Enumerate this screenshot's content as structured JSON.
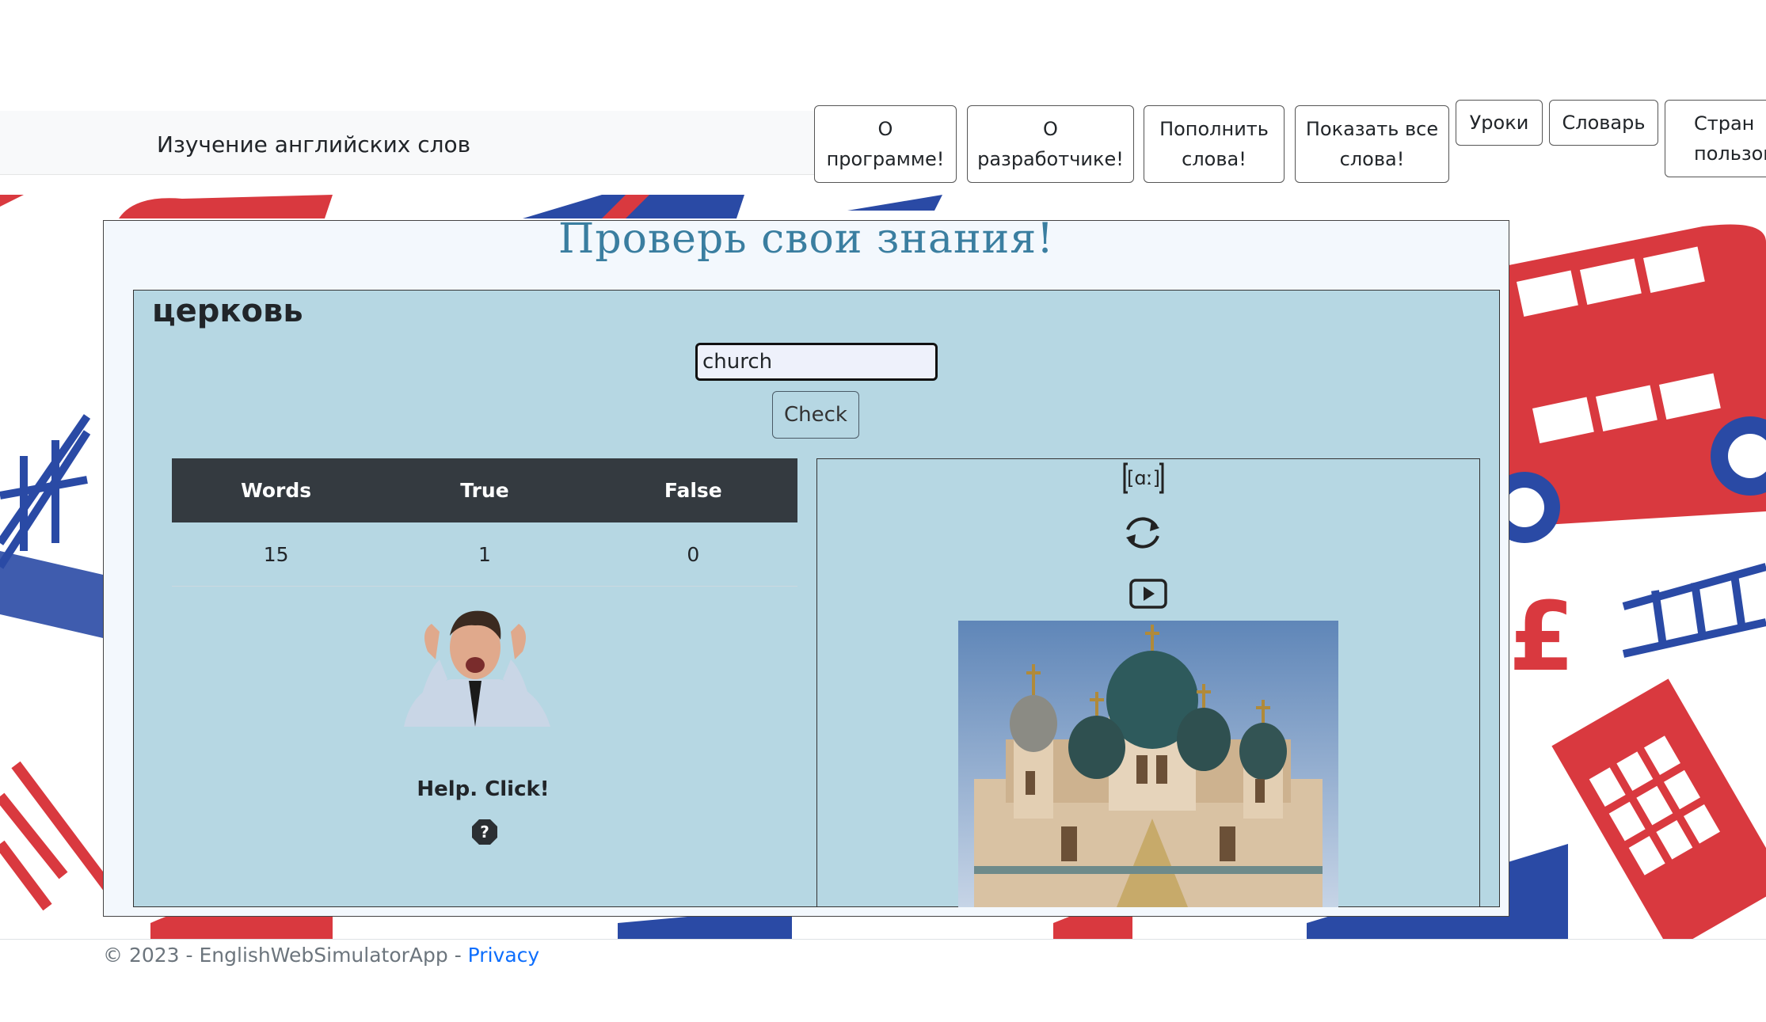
{
  "navbar": {
    "brand": "Изучение английских слов",
    "items": [
      {
        "line1": "О",
        "line2": "программе!"
      },
      {
        "line1": "О",
        "line2": "разработчике!"
      },
      {
        "line1": "Пополнить",
        "line2": "слова!"
      },
      {
        "line1": "Показать все",
        "line2": "слова!"
      },
      {
        "line1": "Уроки"
      },
      {
        "line1": "Словарь"
      },
      {
        "line1": "Стран",
        "line2": "пользов"
      }
    ]
  },
  "main": {
    "title": "Проверь свои знания!",
    "word": "церковь",
    "answer_value": "church",
    "check_label": "Check",
    "stats": {
      "headers": [
        "Words",
        "True",
        "False"
      ],
      "values": [
        "15",
        "1",
        "0"
      ]
    },
    "help_label": "Help. Click!",
    "icons": {
      "transcription": "[ɑː]",
      "refresh": "refresh-icon",
      "play": "play-icon",
      "help": "?"
    }
  },
  "footer": {
    "copyright": "© 2023 - EnglishWebSimulatorApp - ",
    "privacy_label": "Privacy"
  },
  "colors": {
    "title": "#3a7ea0",
    "panel": "#b6d7e3",
    "table_header": "#343a40",
    "bg_red": "#d9393f",
    "bg_blue": "#2a4aa5"
  }
}
